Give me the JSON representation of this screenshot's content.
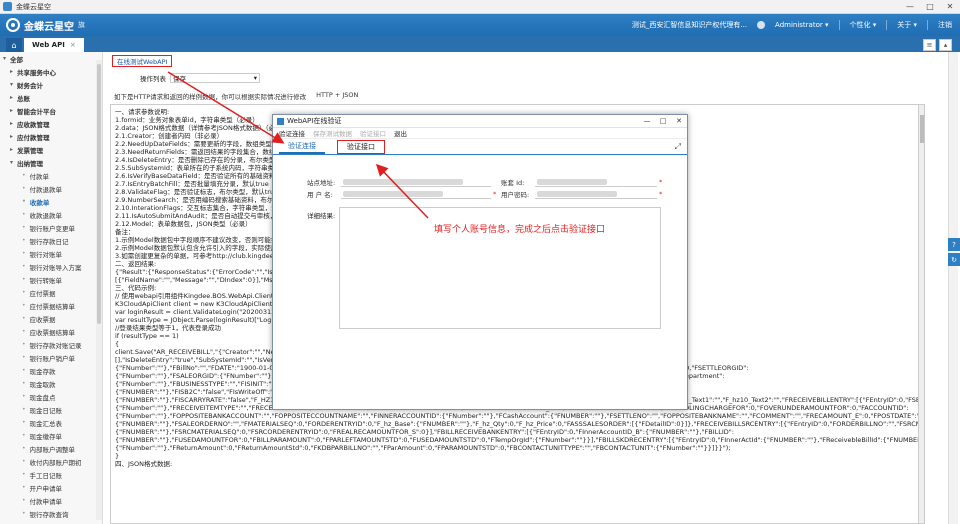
{
  "window": {
    "title": "金蝶云星空"
  },
  "header": {
    "logo_text": "金蝶云星空",
    "logo_sub": "旗",
    "org": "测试_西安汇智信息知识产权代理有...",
    "user": "Administrator ▾",
    "personalize": "个性化 ▾",
    "about": "关于 ▾",
    "logout": "注销"
  },
  "tabs": {
    "home_icon": "home-icon",
    "active_label": "Web API",
    "close": "×"
  },
  "sidebar": {
    "items": [
      {
        "label": "全部",
        "level": 0,
        "expander": "▾"
      },
      {
        "label": "共享服务中心",
        "level": 1,
        "expander": "▸"
      },
      {
        "label": "财务会计",
        "level": 1,
        "expander": "▾"
      },
      {
        "label": "总账",
        "level": 1,
        "expander": "▸"
      },
      {
        "label": "智能会计平台",
        "level": 1,
        "expander": "▸"
      },
      {
        "label": "应收款管理",
        "level": 1,
        "expander": "▸"
      },
      {
        "label": "应付款管理",
        "level": 1,
        "expander": "▸"
      },
      {
        "label": "发票管理",
        "level": 1,
        "expander": "▸"
      },
      {
        "label": "出纳管理",
        "level": 1,
        "expander": "▾"
      },
      {
        "label": "付款单",
        "level": 2
      },
      {
        "label": "付款退款单",
        "level": 2
      },
      {
        "label": "收款单",
        "level": 2,
        "active": true
      },
      {
        "label": "收款退款单",
        "level": 2
      },
      {
        "label": "银行账户变更单",
        "level": 2
      },
      {
        "label": "银行存款日记",
        "level": 2
      },
      {
        "label": "银行对账单",
        "level": 2
      },
      {
        "label": "银行对账导入方案",
        "level": 2
      },
      {
        "label": "银行转账单",
        "level": 2
      },
      {
        "label": "应付票据",
        "level": 2
      },
      {
        "label": "应付票据结算单",
        "level": 2
      },
      {
        "label": "应收票据",
        "level": 2
      },
      {
        "label": "应收票据结算单",
        "level": 2
      },
      {
        "label": "银行存款对账记录",
        "level": 2
      },
      {
        "label": "银行账户销户单",
        "level": 2
      },
      {
        "label": "现金存款",
        "level": 2
      },
      {
        "label": "现金取款",
        "level": 2
      },
      {
        "label": "现金盘点",
        "level": 2
      },
      {
        "label": "现金日记账",
        "level": 2
      },
      {
        "label": "现金汇总表",
        "level": 2
      },
      {
        "label": "现金缴存单",
        "level": 2
      },
      {
        "label": "内部账户调整单",
        "level": 2
      },
      {
        "label": "收付内部账户期初",
        "level": 2
      },
      {
        "label": "手工日记账",
        "level": 2
      },
      {
        "label": "开户申请单",
        "level": 2
      },
      {
        "label": "付款申请单",
        "level": 2
      },
      {
        "label": "银行存款查询",
        "level": 2
      }
    ]
  },
  "main": {
    "link_online_test": "在线测试WebAPI",
    "operation_label": "操作列表",
    "operation_value": "保存",
    "hint_text": "如下是HTTP请求和返回的样例数据，你可以根据实际情况进行修改",
    "hint_suffix": "HTTP + JSON",
    "doc_lines": [
      "一、请求参数说明:",
      "1.formid：业务对象表单id，字符串类型（必录）",
      "2.data：JSON格式数据（详情参考JSON格式数据）（必录）",
      "    2.1.Creator：创建者内码（非必录）",
      "    2.2.NeedUpDateFields：需要更新的字段，数组类型，格式",
      "    2.3.NeedReturnFields：需返回结果的字段集合，数组类型",
      "    2.4.IsDeleteEntry：是否删除已存在的分录，布尔类型，默认",
      "    2.5.SubSystemId：表单所在的子系统内码，字符串类型（非",
      "    2.6.IsVerifyBaseDataField：是否验证所有的基础资料有效",
      "    2.7.IsEntryBatchFill：是否批量填充分录，默认true（非必",
      "    2.8.ValidateFlag：是否验证标志，布尔类型，默认true",
      "    2.9.NumberSearch：是否用编码搜索基础资料，布尔类型，",
      "    2.10.InterationFlags：交互标志集合，字符串类型，分号",
      "    2.11.IsAutoSubmitAndAudit：是否自动提交与审核，布尔",
      "    2.12.Model：表单数据包，JSON类型（必录）",
      "备注：",
      "1.示例Model数据包中字段顺序不建议改变，否则可能会有问",
      "2.示例Model数据包默认包含允许引入的字段，实际使用时",
      "3.如需创建更复杂的单据，可参考http://club.kingdee.com/forum",
      "",
      "二、返回结果:",
      "{\"Result\":{\"ResponseStatus\":{\"ErrorCode\":\"\",\"IsSuccess\"",
      "[{\"FieldName\":\"\",\"Message\":\"\",\"DIndex\":0}],\"MsgCode\":",
      "",
      "三、代码示例:",
      "// 使用webapi引用组件Kingdee.BOS.WebApi.Client.dll",
      "K3CloudApiClient client = new K3CloudApiClient(\"https",
      "var loginResult = client.ValidateLogin(\"20200313160952",
      "var resultType = JObject.Parse(loginResult)[\"LoginResu",
      "//登录结果类型等于1，代表登录成功",
      "if (resultType == 1)",
      "{",
      "        client.Save(\"AR_RECEIVEBILL\",\"{\"Creator\":\"\",\"NeedUpDateFields\":[],\"NeedReturnFields\":[],\"IsDeleteEntry\":\"true\"...",
      "[],\"IsDeleteEntry\":\"true\",\"SubSystemId\":\"\",\"IsVerifyBaseDataField\":\"false\",\"IsEntryBatchFill\":\"true\",\"ValidateFlag\":\"true\",\"NumberSearch\":\"true\",\"FID\":0,\"FBillTypeID\":",
      "{\"FNumber\":\"\"},\"FBillNo\":\"\",\"FDATE\":\"1900-01-01\",\"FCONTACTUNITTYPE\":\"\",\"FCONTACTUNIT\":{\"FNumber\":\"\"},\"FPAYUNITTYPE\":\"\",\"FPAYUNIT\":{\"FNumber\":\"\"},\"FSETTLERATE\":0,\"FSETTLEORGID\":",
      "{\"FNumber\":\"\"},\"FSALEORGID\":{\"FNumber\":\"\"},\"FSALEDEPTID\":{\"FNumber\":\"\"},\"FSALEGROUPID\":{\"FNumber\":\"\"},\"FSALEERID\":{\"FNumber\":\"\"},\"FDOCUMENTSTATUS\":\"\",\"FDepartment\":",
      "{\"FNumber\":\"\"},\"FBUSINESSTYPE\":\"\",\"FISINIT\":\"false\",\"FEXCHANGERATE\":0,\"FCancelStatus\":\"\",\"FScanPoint\":{\"FNUMBER\":\"\"},\"FSETTLECUR\":",
      "{\"FNUMBER\":\"\"},\"FISB2C\":\"false\",\"FIsWriteOff\":\"false\",\"FMatchMethodID\":0,\"FKDPAYNO\":\"\",\"FREMARK\":\"\",\"FTHIRDBILLNO\":\"\",\"FSETTLEMAINBOOKID\":",
      "{\"FNUMBER\":\"\"},\"FISCARRYRATE\":\"false\",\"F_HZ1_Text\":\"\",\"F_hz2_Text\":\"\",\"F_hz3_Text\":\"\",\"F_hz4_Text\":\"\",\"F_hz5_Text\":\"\",\"F_hz6_Text\":\"\",\"F_hz7_Text\":\"\",\"F_hz8_Text1\":\"\",\"F_hz9_Text1\":\"\",\"F_hz10_Text2\":\"\",\"FRECEIVEBILLENTRY\":[{\"FEntryID\":0,\"FSETTLETYPEID\":{\"FNumber\":\"\"},\"FPURPOSEID\":",
      "{\"FNumber\":\"\"},\"FRECEIVEITEMTYPE\":\"\",\"FRECEIVEITEM\":\"\",\"FSaleOrderID\":0,\"FRECTOTALAMOUNTFOR\":0,\"FDISCOUNTAMOUNTFOR_E\":0,\"FSETTLEDISTAMOUNTFOR\":0,\"FHANDLINGCHARGEFOR\":0,\"FOVERUNDERAMOUNTFOR\":0,\"FACCOUNTID\":",
      "{\"FNumber\":\"\"},\"FOPPOSITEBANKACCOUNT\":\"\",\"FOPPOSITECCOUNTNAME\":\"\",\"FINNERACCOUNTID\":{\"FNumber\":\"\"},\"FCashAccount\":{\"FNUMBER\":\"\"},\"FSETTLENO\":\"\",\"FOPPOSITEBANKNAME\":\"\",\"FCOMMENT\":\"\",\"FRECAMOUNT_E\":0,\"FPOSTDATE\":\"1900-01-01\",\"FMATERIALID\":",
      "{\"FNUMBER\":\"\"},\"FSALEORDERNO\":\"\",\"FMATERIALSEQ\":0,\"FORDERENTRYID\":0,\"F_hz_Base\":{\"FNUMBER\":\"\"},\"F_hz_Qty\":0,\"F_hz_Price\":0,\"FASSSALESORDER\":[{\"FDetailID\":0}]},\"FRECEIVEBILLSRCENTRY\":[{\"FEntryID\":0,\"FORDERBILLNO\":\"\",\"FSRCMATERIALID\":",
      "{\"FNUMBER\":\"\"},\"FSRCMATERIALSEQ\":0,\"FSRCORDERENTRYID\":0,\"FREALRECAMOUNTFOR_S\":0}],\"FBILLRECEIVEBANKENTRY\":[{\"FEntryID\":0,\"FInnerAccountID_B\":{\"FNUMBER\":\"\"},\"FBILLID\":",
      "{\"FNUMBER\":\"\"},\"FUSEDAMOUNTFOR\":0,\"FBILLPARAMOUNT\":0,\"FPARLEFTAMOUNTSTD\":0,\"FUSEDAMOUNTSTD\":0,\"FTempOrgId\":{\"FNumber\":\"\"}}],\"FBILLSKDRECENTRY\":[{\"FEntryID\":0,\"FInnerActId\":{\"FNUMBER\":\"\"},\"FReceivebleBillId\":{\"FNUMBER\":\"\"},\"FPayPurse\":",
      "{\"FNumber\":\"\"},\"FReturnAmount\":0,\"FReturnAmountStd\":0,\"FKDBPARBILLNO\":\"\",\"FParAmount\":0,\"FPARAMOUNTSTD\":0,\"FBCONTACTUNITTYPE\":\"\",\"FBCONTACTUNIT\":{\"FNumber\":\"\"}}]}}\");",
      "}",
      "",
      "四、JSON格式数据:"
    ]
  },
  "dialog": {
    "title": "WebAPI在线验证",
    "menu": [
      "验证连接",
      "保存测试数据",
      "验证接口",
      "退出"
    ],
    "tabs": {
      "connect": "验证连接",
      "interface": "验证接口"
    },
    "fields": {
      "site_label": "站点地址:",
      "account_label": "账套 Id:",
      "username_label": "用 户 名:",
      "password_label": "用户密码:",
      "detail_label": "详细结果:"
    },
    "required_mark": "*",
    "callout": "填写个人账号信息，完成之后点击验证接口"
  },
  "icons": {
    "minimize": "—",
    "maximize": "□",
    "close": "✕",
    "expand": "⤢"
  },
  "colors": {
    "accent": "#1f6db3",
    "annotation": "#e02020"
  }
}
